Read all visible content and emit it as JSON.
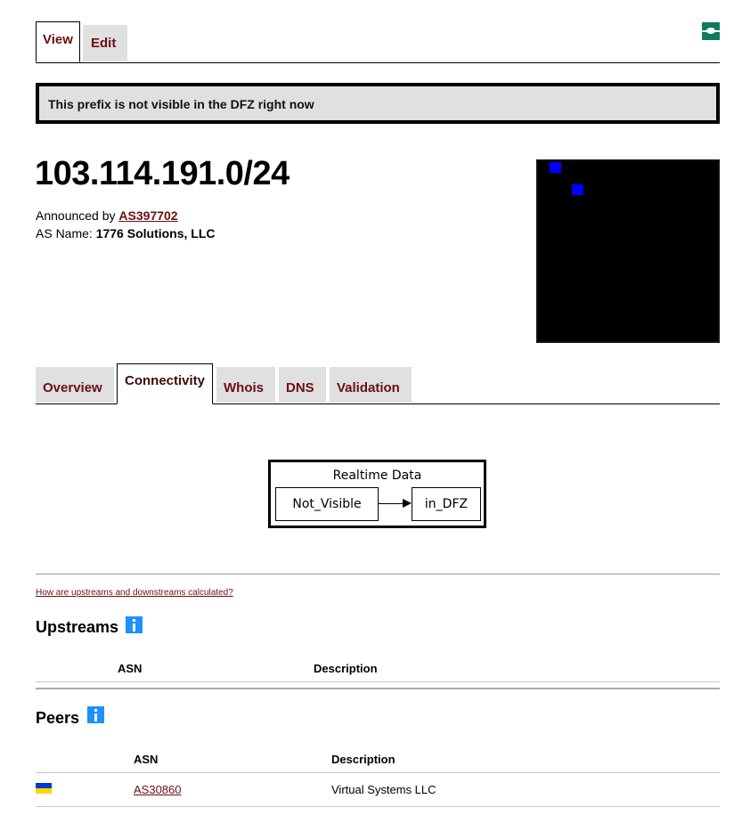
{
  "top_tabs": [
    {
      "label": "View",
      "active": true
    },
    {
      "label": "Edit",
      "active": false
    }
  ],
  "top_icon": "connector-icon",
  "banner": {
    "text": "This prefix is not visible in the DFZ right now"
  },
  "prefix": {
    "title": "103.114.191.0/24",
    "announced_by_label": "Announced by",
    "announced_by_asn": "AS397702",
    "as_name_label": "AS Name:",
    "as_name_value": "1776 Solutions, LLC"
  },
  "heatmap": {
    "cells_lit": 2,
    "cell_color": "#0000ff",
    "background": "#000000"
  },
  "section_tabs": [
    {
      "label": "Overview",
      "active": false
    },
    {
      "label": "Connectivity",
      "active": true
    },
    {
      "label": "Whois",
      "active": false
    },
    {
      "label": "DNS",
      "active": false
    },
    {
      "label": "Validation",
      "active": false
    }
  ],
  "graph": {
    "title": "Realtime Data",
    "nodes": [
      "Not_Visible",
      "in_DFZ"
    ]
  },
  "help_link": "How are upstreams and downstreams calculated?",
  "upstreams": {
    "title": "Upstreams",
    "columns": [
      "ASN",
      "Description"
    ],
    "rows": []
  },
  "peers": {
    "title": "Peers",
    "columns": [
      "ASN",
      "Description"
    ],
    "rows": [
      {
        "flag": "ukraine-flag",
        "asn": "AS30860",
        "description": "Virtual Systems LLC"
      }
    ]
  },
  "colors": {
    "link": "#6b0f0f",
    "info": "#1e90ff",
    "tab_bg": "#e0e0e0",
    "icon_green": "#0f7a5c"
  }
}
